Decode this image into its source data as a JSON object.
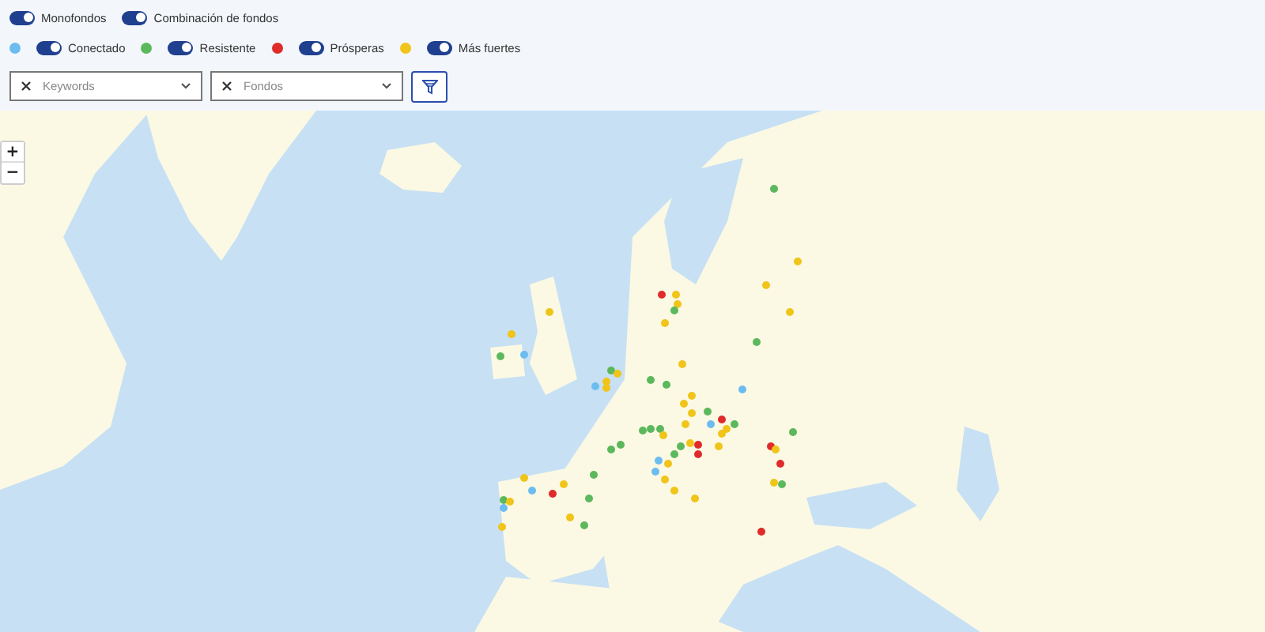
{
  "toggles": [
    {
      "label": "Monofondos",
      "on": true
    },
    {
      "label": "Combinación de fondos",
      "on": true
    }
  ],
  "legend": [
    {
      "label": "Conectado",
      "color": "#6cbcf0",
      "on": true
    },
    {
      "label": "Resistente",
      "color": "#5cb85c",
      "on": true
    },
    {
      "label": "Prósperas",
      "color": "#e02b2b",
      "on": true
    },
    {
      "label": "Más fuertes",
      "color": "#f0c419",
      "on": true
    }
  ],
  "filters": [
    {
      "placeholder": "Keywords"
    },
    {
      "placeholder": "Fondos"
    }
  ],
  "zoom_controls": [
    "+",
    "−"
  ],
  "markers": [
    {
      "color": "#f0c419"
    },
    {
      "color": "#f0c419"
    },
    {
      "color": "#5cb85c"
    },
    {
      "color": "#6cbcf0"
    },
    {
      "color": "#5cb85c"
    },
    {
      "color": "#f0c419"
    },
    {
      "color": "#f0c419"
    },
    {
      "color": "#f0c419"
    },
    {
      "color": "#6cbcf0"
    },
    {
      "color": "#5cb85c"
    },
    {
      "color": "#5cb85c"
    },
    {
      "color": "#5cb85c"
    },
    {
      "color": "#f0c419"
    },
    {
      "color": "#6cbcf0"
    },
    {
      "color": "#e02b2b"
    },
    {
      "color": "#f0c419"
    },
    {
      "color": "#5cb85c"
    },
    {
      "color": "#5cb85c"
    },
    {
      "color": "#f0c419"
    },
    {
      "color": "#6cbcf0"
    },
    {
      "color": "#f0c419"
    },
    {
      "color": "#5cb85c"
    },
    {
      "color": "#f0c419"
    },
    {
      "color": "#5cb85c"
    },
    {
      "color": "#f0c419"
    },
    {
      "color": "#f0c419"
    },
    {
      "color": "#f0c419"
    },
    {
      "color": "#e02b2b"
    },
    {
      "color": "#f0c419"
    },
    {
      "color": "#f0c419"
    },
    {
      "color": "#5cb85c"
    },
    {
      "color": "#f0c419"
    },
    {
      "color": "#5cb85c"
    },
    {
      "color": "#f0c419"
    },
    {
      "color": "#5cb85c"
    },
    {
      "color": "#5cb85c"
    },
    {
      "color": "#6cbcf0"
    },
    {
      "color": "#f0c419"
    },
    {
      "color": "#f0c419"
    },
    {
      "color": "#f0c419"
    },
    {
      "color": "#5cb85c"
    },
    {
      "color": "#e02b2b"
    },
    {
      "color": "#5cb85c"
    },
    {
      "color": "#6cbcf0"
    },
    {
      "color": "#f0c419"
    },
    {
      "color": "#f0c419"
    },
    {
      "color": "#f0c419"
    },
    {
      "color": "#5cb85c"
    },
    {
      "color": "#5cb85c"
    },
    {
      "color": "#5cb85c"
    },
    {
      "color": "#f0c419"
    },
    {
      "color": "#5cb85c"
    },
    {
      "color": "#e02b2b"
    },
    {
      "color": "#f0c419"
    },
    {
      "color": "#e02b2b"
    },
    {
      "color": "#e02b2b"
    },
    {
      "color": "#f0c419"
    },
    {
      "color": "#5cb85c"
    },
    {
      "color": "#f0c419"
    },
    {
      "color": "#5cb85c"
    },
    {
      "color": "#e02b2b"
    },
    {
      "color": "#6cbcf0"
    },
    {
      "color": "#6cbcf0"
    },
    {
      "color": "#f0c419"
    },
    {
      "color": "#f0c419"
    },
    {
      "color": "#f0c419"
    },
    {
      "color": "#f0c419"
    },
    {
      "color": "#f0c419"
    },
    {
      "color": "#5cb85c"
    },
    {
      "color": "#e02b2b"
    }
  ]
}
